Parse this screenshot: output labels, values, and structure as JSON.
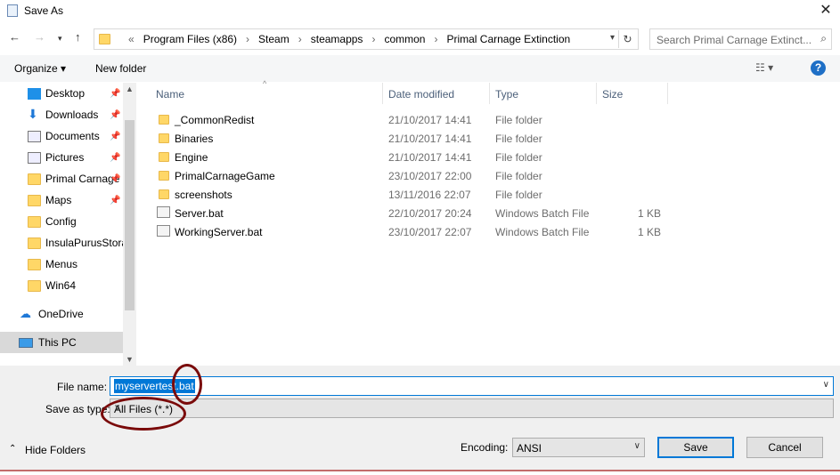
{
  "window": {
    "title": "Save As",
    "close": "✕"
  },
  "address": {
    "crumbs": [
      "«",
      "Program Files (x86)",
      "›",
      "Steam",
      "›",
      "steamapps",
      "›",
      "common",
      "›",
      "Primal Carnage Extinction"
    ],
    "search_placeholder": "Search Primal Carnage Extinct..."
  },
  "toolbar": {
    "organize": "Organize ▾",
    "new_folder": "New folder",
    "help": "?"
  },
  "nav": [
    {
      "label": "Desktop",
      "icon": "desktop-icon",
      "pinned": true
    },
    {
      "label": "Downloads",
      "icon": "download-icon",
      "pinned": true
    },
    {
      "label": "Documents",
      "icon": "documents-icon",
      "pinned": true
    },
    {
      "label": "Pictures",
      "icon": "pictures-icon",
      "pinned": true
    },
    {
      "label": "Primal Carnage Extinction",
      "icon": "folder-icon",
      "pinned": true
    },
    {
      "label": "Maps",
      "icon": "folder-icon",
      "pinned": true
    },
    {
      "label": "Config",
      "icon": "folder-icon",
      "pinned": false
    },
    {
      "label": "InsulaPurusStorage",
      "icon": "folder-icon",
      "pinned": false
    },
    {
      "label": "Menus",
      "icon": "folder-icon",
      "pinned": false
    },
    {
      "label": "Win64",
      "icon": "folder-icon",
      "pinned": false
    }
  ],
  "onedrive": "OneDrive",
  "thispc": "This PC",
  "columns": {
    "name": "Name",
    "date": "Date modified",
    "type": "Type",
    "size": "Size"
  },
  "files": [
    {
      "name": "_CommonRedist",
      "date": "21/10/2017 14:41",
      "type": "File folder",
      "size": "",
      "kind": "folder"
    },
    {
      "name": "Binaries",
      "date": "21/10/2017 14:41",
      "type": "File folder",
      "size": "",
      "kind": "folder"
    },
    {
      "name": "Engine",
      "date": "21/10/2017 14:41",
      "type": "File folder",
      "size": "",
      "kind": "folder"
    },
    {
      "name": "PrimalCarnageGame",
      "date": "23/10/2017 22:00",
      "type": "File folder",
      "size": "",
      "kind": "folder"
    },
    {
      "name": "screenshots",
      "date": "13/11/2016 22:07",
      "type": "File folder",
      "size": "",
      "kind": "folder"
    },
    {
      "name": "Server.bat",
      "date": "22/10/2017 20:24",
      "type": "Windows Batch File",
      "size": "1 KB",
      "kind": "bat"
    },
    {
      "name": "WorkingServer.bat",
      "date": "23/10/2017 22:07",
      "type": "Windows Batch File",
      "size": "1 KB",
      "kind": "bat"
    }
  ],
  "form": {
    "file_name_label": "File name:",
    "file_name_value": "myservertest.bat",
    "save_type_label": "Save as type:",
    "save_type_value": "All Files  (*.*)",
    "encoding_label": "Encoding:",
    "encoding_value": "ANSI",
    "hide_folders": "Hide Folders",
    "save": "Save",
    "cancel": "Cancel"
  },
  "colors": {
    "accent": "#0078d7",
    "annotation": "#7a0a0a"
  }
}
